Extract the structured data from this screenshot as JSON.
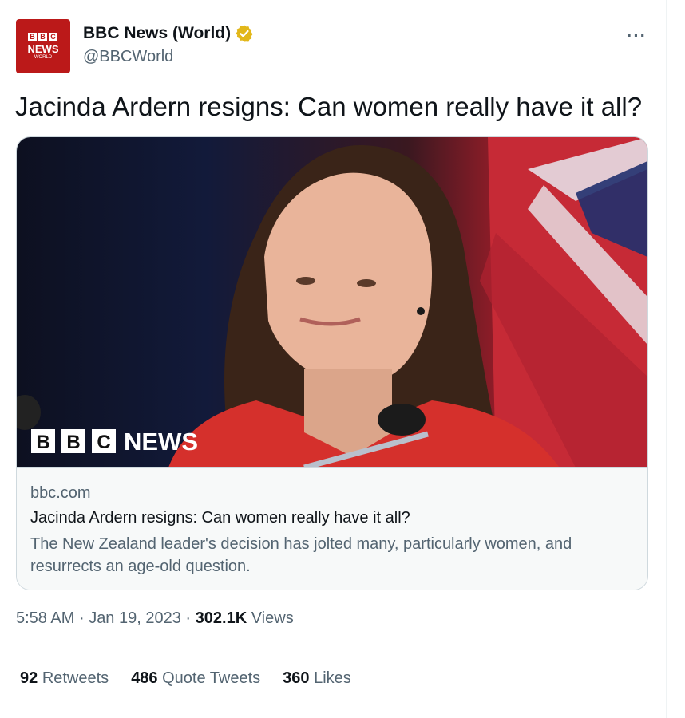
{
  "account": {
    "display_name": "BBC News (World)",
    "handle": "@BBCWorld",
    "avatar_blocks": [
      "B",
      "B",
      "C"
    ],
    "avatar_news": "NEWS",
    "avatar_world": "WORLD",
    "brand_color": "#bb1919",
    "verified_icon": "verified-badge-gold"
  },
  "more_menu": "···",
  "tweet": {
    "text": "Jacinda Ardern resigns: Can women really have it all?"
  },
  "card": {
    "image_logo_blocks": [
      "B",
      "B",
      "C"
    ],
    "image_logo_news": "NEWS",
    "domain": "bbc.com",
    "title": "Jacinda Ardern resigns: Can women really have it all?",
    "description": "The New Zealand leader's decision has jolted many, particularly women, and resurrects an age-old question."
  },
  "meta": {
    "time": "5:58 AM",
    "sep1": "·",
    "date": "Jan 19, 2023",
    "sep2": "·",
    "views_count": "302.1K",
    "views_label": "Views"
  },
  "stats": {
    "retweets_count": "92",
    "retweets_label": "Retweets",
    "quotes_count": "486",
    "quotes_label": "Quote Tweets",
    "likes_count": "360",
    "likes_label": "Likes"
  },
  "colors": {
    "text_primary": "#0f1419",
    "text_secondary": "#536471",
    "border": "#cfd9de"
  }
}
